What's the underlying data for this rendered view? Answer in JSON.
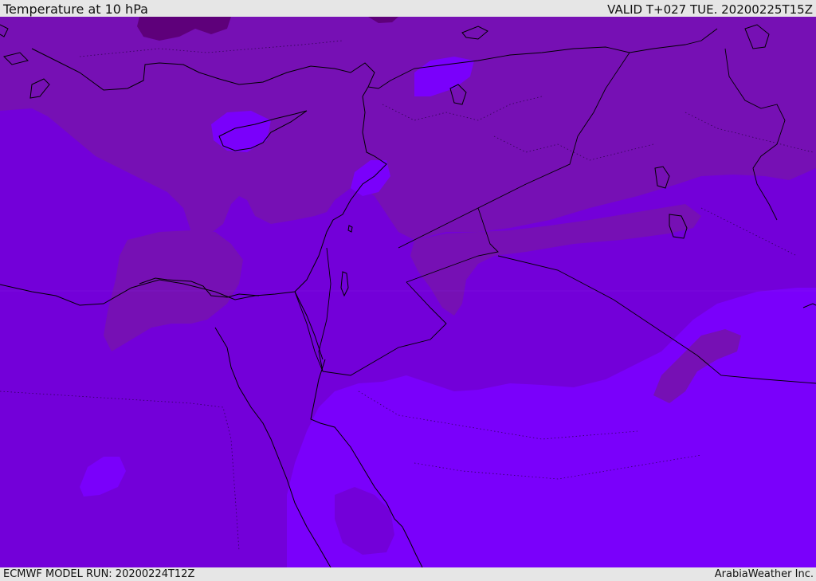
{
  "header": {
    "title": "Temperature at 10 hPa",
    "valid_time": "VALID T+027 TUE. 20200225T15Z"
  },
  "footer": {
    "model_run": "ECMWF MODEL RUN: 20200224T12Z",
    "credit": "ArabiaWeather Inc."
  },
  "map": {
    "colors": {
      "band_cold": "#5e007a",
      "band_cool": "#7610b4",
      "band_mid": "#7300d9",
      "band_warm": "#7a00fb",
      "coastline": "#000000",
      "border": "#000000"
    }
  }
}
